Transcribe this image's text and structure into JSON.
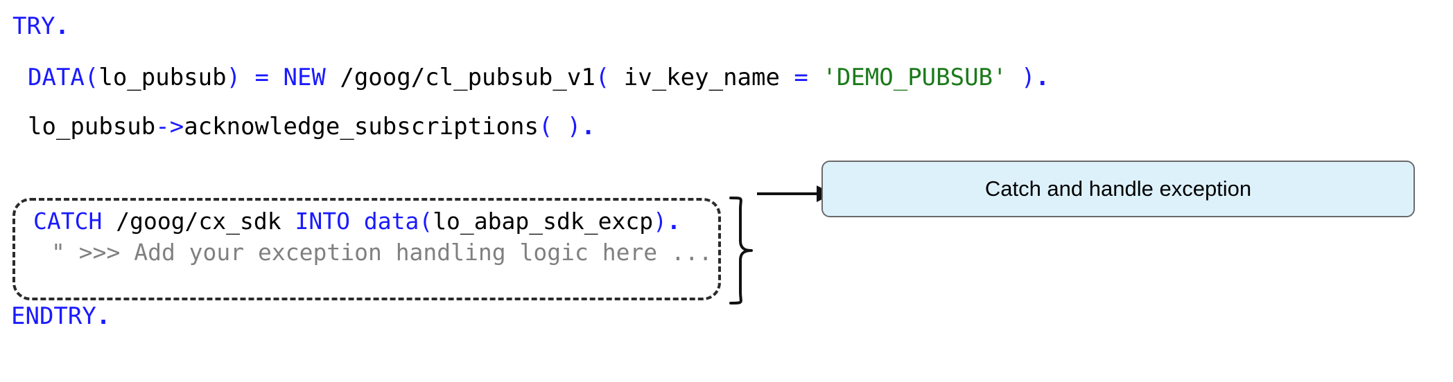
{
  "code": {
    "language": "ABAP",
    "lines": [
      {
        "id": "try",
        "tokens": [
          {
            "text": "TRY",
            "kind": "keyword"
          },
          {
            "text": ".",
            "kind": "punct-bold"
          }
        ]
      },
      {
        "id": "data",
        "tokens": [
          {
            "text": "DATA(",
            "kind": "keyword"
          },
          {
            "text": "lo_pubsub",
            "kind": "plain"
          },
          {
            "text": ") = NEW ",
            "kind": "keyword"
          },
          {
            "text": "/goog/cl_pubsub_v1",
            "kind": "plain"
          },
          {
            "text": "(",
            "kind": "keyword"
          },
          {
            "text": " iv_key_name ",
            "kind": "plain"
          },
          {
            "text": "= ",
            "kind": "keyword"
          },
          {
            "text": "'DEMO_PUBSUB'",
            "kind": "string"
          },
          {
            "text": " )",
            "kind": "keyword"
          },
          {
            "text": ".",
            "kind": "punct-bold"
          }
        ]
      },
      {
        "id": "call",
        "tokens": [
          {
            "text": "lo_pubsub",
            "kind": "plain"
          },
          {
            "text": "->",
            "kind": "keyword"
          },
          {
            "text": "acknowledge_subscriptions",
            "kind": "plain"
          },
          {
            "text": "( )",
            "kind": "keyword"
          },
          {
            "text": ".",
            "kind": "punct-bold"
          }
        ]
      },
      {
        "id": "catch",
        "tokens": [
          {
            "text": "CATCH ",
            "kind": "keyword"
          },
          {
            "text": "/goog/cx_sdk ",
            "kind": "plain"
          },
          {
            "text": "INTO ",
            "kind": "keyword"
          },
          {
            "text": "data(",
            "kind": "keyword"
          },
          {
            "text": "lo_abap_sdk_excp",
            "kind": "plain"
          },
          {
            "text": ")",
            "kind": "keyword"
          },
          {
            "text": ".",
            "kind": "punct-bold"
          }
        ]
      },
      {
        "id": "comment",
        "tokens": [
          {
            "text": "\" >>> Add your exception handling logic here ...",
            "kind": "comment"
          }
        ]
      },
      {
        "id": "endtry",
        "tokens": [
          {
            "text": "ENDTRY",
            "kind": "keyword"
          },
          {
            "text": ".",
            "kind": "punct-bold"
          }
        ]
      }
    ]
  },
  "annotation": {
    "callout_label": "Catch and handle exception",
    "highlight_shape": "dashed-rounded-rectangle",
    "connector": "curly-brace-then-arrow"
  },
  "colors": {
    "keyword": "#1a1aff",
    "string": "#1a7a1a",
    "comment": "#808080",
    "plain": "#000000",
    "dash_border": "#2b2b2b",
    "callout_fill": "#ddf1fb",
    "callout_border": "#6a6a6a",
    "background": "#ffffff"
  }
}
